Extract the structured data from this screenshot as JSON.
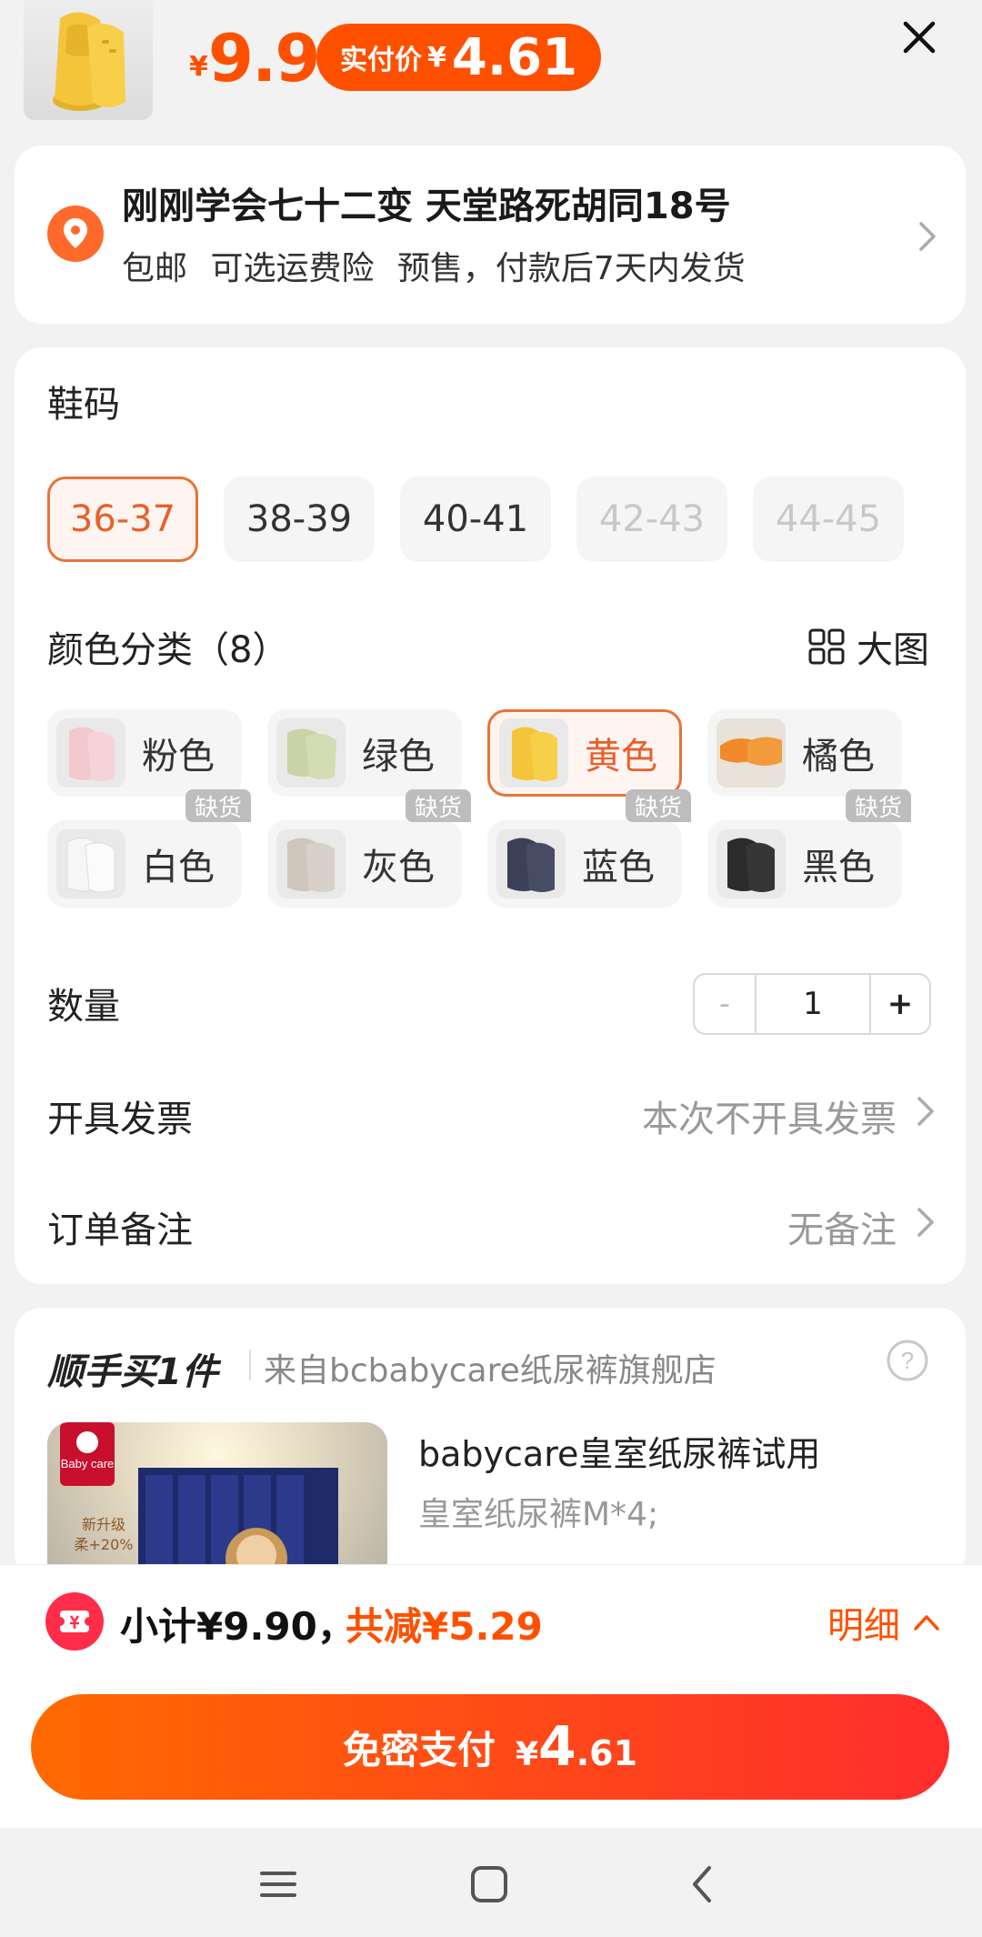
{
  "header": {
    "original_price_symbol": "¥",
    "original_price": "9.9",
    "pay_label": "实付价",
    "pay_symbol": "¥",
    "pay_price": "4.61"
  },
  "address": {
    "name_line": "刚刚学会七十二变 天堂路死胡同18号",
    "shipping_line": "包邮 可选运费险 预售，付款后7天内发货"
  },
  "size": {
    "label": "鞋码",
    "options": [
      {
        "label": "36-37",
        "state": "selected"
      },
      {
        "label": "38-39",
        "state": "normal"
      },
      {
        "label": "40-41",
        "state": "normal"
      },
      {
        "label": "42-43",
        "state": "disabled"
      },
      {
        "label": "44-45",
        "state": "disabled"
      }
    ]
  },
  "color": {
    "label": "颜色分类（8）",
    "big_image_label": "大图",
    "out_of_stock_label": "缺货",
    "options": [
      {
        "label": "粉色",
        "swatch": "#f3c9cf"
      },
      {
        "label": "绿色",
        "swatch": "#c9d3a6"
      },
      {
        "label": "黄色",
        "swatch": "#f5c63a"
      },
      {
        "label": "橘色",
        "swatch": "#f08a2a"
      },
      {
        "label": "白色",
        "swatch": "#f3f3f3"
      },
      {
        "label": "灰色",
        "swatch": "#cfc7bd"
      },
      {
        "label": "蓝色",
        "swatch": "#3c4058"
      },
      {
        "label": "黑色",
        "swatch": "#2b2b2b"
      }
    ]
  },
  "quantity": {
    "label": "数量",
    "minus": "-",
    "value": "1",
    "plus": "+"
  },
  "invoice": {
    "label": "开具发票",
    "value": "本次不开具发票"
  },
  "remark": {
    "label": "订单备注",
    "value": "无备注"
  },
  "addon": {
    "title": "顺手买1件",
    "source": "来自bcbabycare纸尿裤旗舰店",
    "product_name": "babycare皇室纸尿裤试用",
    "product_spec": "皇室纸尿裤M*4;",
    "product_image_brand": "Baby care",
    "product_image_tag": "新升级",
    "product_image_tag2": "柔+20%"
  },
  "summary": {
    "subtotal": "小计¥9.90，",
    "discount": "共减¥5.29",
    "detail_label": "明细"
  },
  "pay_button": {
    "label": "免密支付",
    "symbol": "¥",
    "int": "4",
    "dec": ".61"
  },
  "colors": {
    "accent": "#ff5000",
    "selected_border": "#e8733a",
    "pay_gradient_start": "#ff6a00",
    "pay_gradient_end": "#ff2d2d"
  }
}
